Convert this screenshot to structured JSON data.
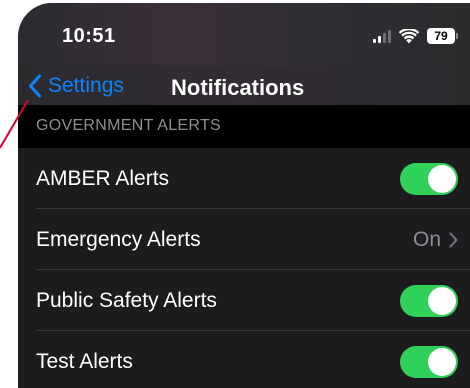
{
  "status_bar": {
    "time": "10:51",
    "battery_level": "79"
  },
  "nav": {
    "back_label": "Settings",
    "title": "Notifications"
  },
  "section": {
    "header": "GOVERNMENT ALERTS"
  },
  "rows": [
    {
      "label": "AMBER Alerts",
      "control": "toggle",
      "on": true
    },
    {
      "label": "Emergency Alerts",
      "control": "detail",
      "value": "On"
    },
    {
      "label": "Public Safety Alerts",
      "control": "toggle",
      "on": true
    },
    {
      "label": "Test Alerts",
      "control": "toggle",
      "on": true
    }
  ],
  "colors": {
    "accent": "#0a84ff",
    "toggle_on": "#30d158",
    "background": "#1c1c1e",
    "secondary_text": "#8e8e93",
    "annotation": "#e0002a"
  },
  "icons": [
    "chevron-left-icon",
    "signal-icon",
    "wifi-icon",
    "battery-icon",
    "chevron-right-icon"
  ]
}
